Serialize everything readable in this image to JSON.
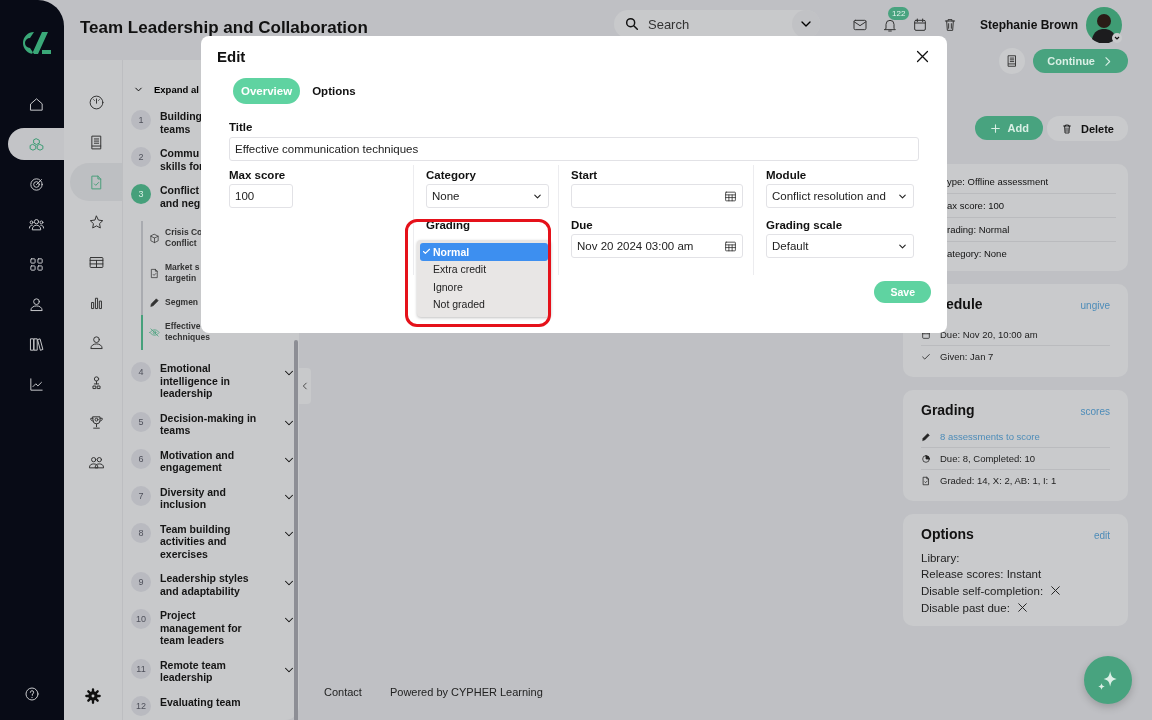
{
  "rail": {
    "items": [
      {
        "selected": false
      },
      {
        "selected": true
      },
      {
        "selected": false
      },
      {
        "selected": false
      },
      {
        "selected": false
      },
      {
        "selected": false
      },
      {
        "selected": false
      },
      {
        "selected": false
      }
    ]
  },
  "header": {
    "title": "Team Leadership and Collaboration",
    "search": {
      "placeholder": "Search"
    },
    "notifications": "122",
    "user": "Stephanie Brown"
  },
  "toolbar": {
    "continue": "Continue",
    "add": "Add",
    "delete": "Delete"
  },
  "nav_icons": [
    {
      "selected": false
    },
    {
      "selected": false
    },
    {
      "selected": true
    },
    {
      "selected": false
    },
    {
      "selected": false
    },
    {
      "selected": false
    },
    {
      "selected": false
    },
    {
      "selected": false
    },
    {
      "selected": false
    },
    {
      "selected": false
    }
  ],
  "outline": {
    "expand_label": "Expand al",
    "modules": [
      {
        "number": "1",
        "title": "Building\nteams",
        "active": false
      },
      {
        "number": "2",
        "title": "Commu\nskills for",
        "active": false
      },
      {
        "number": "3",
        "title": "Conflict\nand neg",
        "active": true,
        "children": [
          {
            "kind": "cube",
            "title": "Crisis Co\nConflict",
            "selected": false
          },
          {
            "kind": "document",
            "title": "Market s\ntargetin",
            "selected": false
          },
          {
            "kind": "pencil",
            "title": "Segmen",
            "selected": false
          },
          {
            "kind": "hidden",
            "title": "Effective\ntechniques",
            "selected": true
          }
        ]
      },
      {
        "number": "4",
        "title": "Emotional\nintelligence in\nleadership",
        "active": false,
        "chevron": true
      },
      {
        "number": "5",
        "title": "Decision-making in\nteams",
        "active": false,
        "chevron": true
      },
      {
        "number": "6",
        "title": "Motivation and\nengagement",
        "active": false,
        "chevron": true
      },
      {
        "number": "7",
        "title": "Diversity and\ninclusion",
        "active": false,
        "chevron": true
      },
      {
        "number": "8",
        "title": "Team building\nactivities and\nexercises",
        "active": false,
        "chevron": true
      },
      {
        "number": "9",
        "title": "Leadership styles\nand adaptability",
        "active": false,
        "chevron": true
      },
      {
        "number": "10",
        "title": "Project\nmanagement for\nteam leaders",
        "active": false,
        "chevron": true
      },
      {
        "number": "11",
        "title": "Remote team\nleadership",
        "active": false,
        "chevron": true
      },
      {
        "number": "12",
        "title": "Evaluating team",
        "active": false,
        "chevron": false
      }
    ]
  },
  "modal": {
    "title": "Edit",
    "tabs": [
      {
        "label": "Overview",
        "selected": true
      },
      {
        "label": "Options",
        "selected": false
      }
    ],
    "title_field": {
      "label": "Title",
      "value": "Effective communication techniques"
    },
    "max_score": {
      "label": "Max score",
      "value": "100"
    },
    "category": {
      "label": "Category",
      "value": "None"
    },
    "grading": {
      "label": "Grading",
      "options": [
        {
          "label": "Normal",
          "selected": true
        },
        {
          "label": "Extra credit",
          "selected": false
        },
        {
          "label": "Ignore",
          "selected": false
        },
        {
          "label": "Not graded",
          "selected": false
        }
      ]
    },
    "start": {
      "label": "Start"
    },
    "due": {
      "label": "Due",
      "value": "Nov 20 2024 03:00 am"
    },
    "module": {
      "label": "Module",
      "value": "Conflict resolution and"
    },
    "grading_scale": {
      "label": "Grading scale",
      "value": "Default"
    },
    "save": "Save"
  },
  "details": [
    "ype: Offline assessment",
    "ax score: 100",
    "rading: Normal",
    "ategory: None"
  ],
  "schedule": {
    "title": "edule",
    "link": "ungive",
    "rows": [
      {
        "kind": "calendar",
        "text": "Due: Nov 20, 10:00 am"
      },
      {
        "kind": "check",
        "text": "Given: Jan 7"
      }
    ]
  },
  "grading_card": {
    "title": "Grading",
    "link": "scores",
    "rows": [
      {
        "kind": "pencil",
        "text": "8 assessments to score",
        "link": true
      },
      {
        "kind": "pie",
        "text": "Due: 8, Completed: 10",
        "link": false
      },
      {
        "kind": "document",
        "text": "Graded: 14, X: 2, AB: 1, I: 1",
        "link": false
      }
    ]
  },
  "options_card": {
    "title": "Options",
    "link": "edit",
    "rows": [
      {
        "text": "Library:"
      },
      {
        "text": "Release scores: Instant"
      },
      {
        "text": "Disable self-completion:",
        "enabled": false
      },
      {
        "text": "Disable past due:",
        "enabled": false
      }
    ]
  },
  "footer": [
    "Contact",
    "Powered by CYPHER Learning"
  ]
}
